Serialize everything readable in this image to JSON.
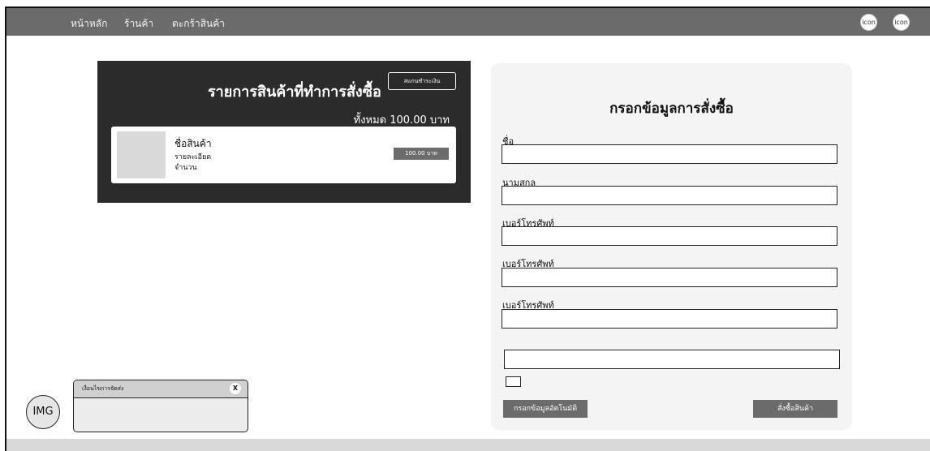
{
  "nav": {
    "links": [
      "หน้าหลัก",
      "ร้านค้า",
      "ตะกร้าสินค้า"
    ],
    "icon_labels": [
      "icon",
      "icon"
    ]
  },
  "order": {
    "title": "รายการสินค้าที่ทำการสั่งซื้อ",
    "scan_button": "สแกนชำระเงิน",
    "total": "ทั้งหมด 100.00 บาท",
    "item": {
      "name": "ชื่อสินค้า",
      "description": "รายละเอียด",
      "quantity": "จำนวน",
      "price": "100.00 บาท"
    }
  },
  "form": {
    "title": "กรอกข้อมูลการสั่งซื้อ",
    "fields": [
      {
        "label": "ชื่อ",
        "value": ""
      },
      {
        "label": "นามสกุล",
        "value": ""
      },
      {
        "label": "เบอร์โทรศัพท์",
        "value": ""
      },
      {
        "label": "เบอร์โทรศัพท์",
        "value": ""
      },
      {
        "label": "เบอร์โทรศัพท์",
        "value": ""
      }
    ],
    "extra_field_value": "",
    "checkbox_checked": false,
    "auto_fill_button": "กรอกข้อมูลอัตโนมัติ",
    "order_button": "สั่งซื้อสินค้า"
  },
  "chat": {
    "avatar_label": "IMG",
    "title": "เงื่อนไขการจัดส่ง",
    "close_label": "X"
  },
  "colors": {
    "navbar": "#6b6b6b",
    "panel_dark": "#2b2b2b",
    "form_bg": "#f4f4f4",
    "button": "#6b6b6b"
  }
}
